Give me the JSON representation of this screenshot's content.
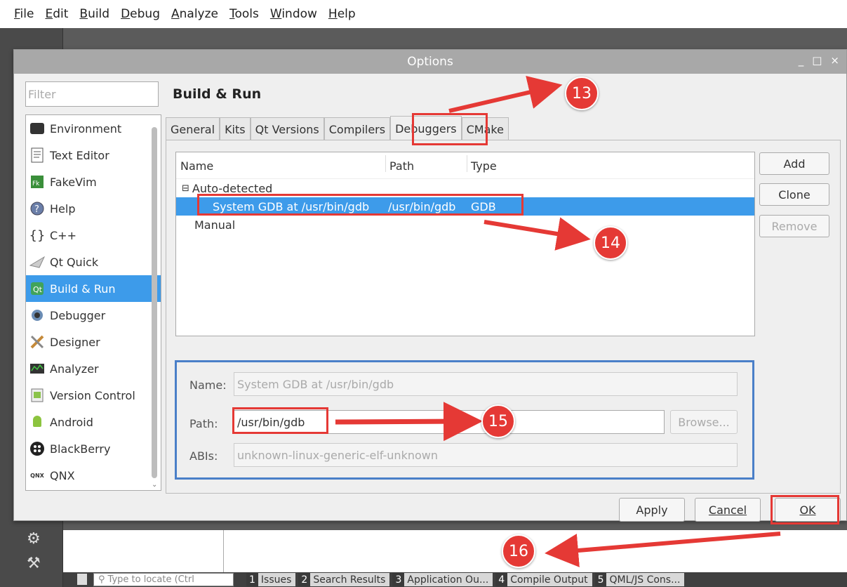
{
  "menubar": {
    "items": [
      "File",
      "Edit",
      "Build",
      "Debug",
      "Analyze",
      "Tools",
      "Window",
      "Help"
    ]
  },
  "dialog": {
    "title": "Options",
    "window_controls": [
      "_",
      "□",
      "×"
    ],
    "filter_placeholder": "Filter",
    "categories": [
      {
        "label": "Environment",
        "icon": "monitor-icon"
      },
      {
        "label": "Text Editor",
        "icon": "text-editor-icon"
      },
      {
        "label": "FakeVim",
        "icon": "fakevim-icon"
      },
      {
        "label": "Help",
        "icon": "help-icon"
      },
      {
        "label": "C++",
        "icon": "braces-icon"
      },
      {
        "label": "Qt Quick",
        "icon": "paper-plane-icon"
      },
      {
        "label": "Build & Run",
        "icon": "build-run-icon",
        "selected": true
      },
      {
        "label": "Debugger",
        "icon": "debugger-icon"
      },
      {
        "label": "Designer",
        "icon": "designer-icon"
      },
      {
        "label": "Analyzer",
        "icon": "analyzer-icon"
      },
      {
        "label": "Version Control",
        "icon": "version-control-icon"
      },
      {
        "label": "Android",
        "icon": "android-icon"
      },
      {
        "label": "BlackBerry",
        "icon": "blackberry-icon"
      },
      {
        "label": "QNX",
        "icon": "qnx-icon"
      }
    ],
    "page_title": "Build & Run",
    "tabs": [
      "General",
      "Kits",
      "Qt Versions",
      "Compilers",
      "Debuggers",
      "CMake"
    ],
    "active_tab": "Debuggers",
    "tree": {
      "columns": [
        "Name",
        "Path",
        "Type"
      ],
      "group_auto": "Auto-detected",
      "group_manual": "Manual",
      "selected_row": {
        "name": "System GDB at /usr/bin/gdb",
        "path": "/usr/bin/gdb",
        "type": "GDB"
      },
      "collapse_glyph": "⊟"
    },
    "side_buttons": {
      "add": "Add",
      "clone": "Clone",
      "remove": "Remove"
    },
    "details": {
      "name_label": "Name:",
      "name_value": "System GDB at /usr/bin/gdb",
      "path_label": "Path:",
      "path_value": "/usr/bin/gdb",
      "browse": "Browse...",
      "abis_label": "ABIs:",
      "abis_value": "unknown-linux-generic-elf-unknown"
    },
    "buttons": {
      "apply": "Apply",
      "cancel": "Cancel",
      "ok": "OK"
    }
  },
  "statusbar": {
    "locate_placeholder": "Type to locate (Ctrl",
    "tabs": [
      {
        "num": "1",
        "label": "Issues"
      },
      {
        "num": "2",
        "label": "Search Results"
      },
      {
        "num": "3",
        "label": "Application Ou..."
      },
      {
        "num": "4",
        "label": "Compile Output"
      },
      {
        "num": "5",
        "label": "QML/JS Cons..."
      }
    ]
  },
  "annotations": {
    "badge_13": "13",
    "badge_14": "14",
    "badge_15": "15",
    "badge_16": "16"
  },
  "colors": {
    "accent": "#3d9bea",
    "annotation": "#e53935",
    "frame_blue": "#4a7fc8"
  }
}
